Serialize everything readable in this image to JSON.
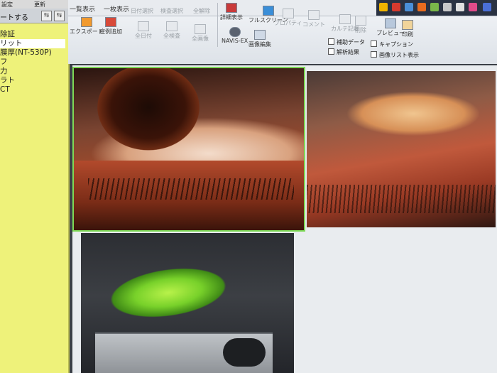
{
  "left_panel": {
    "top_labels": [
      "設定",
      "更新"
    ],
    "row2_label": "ートする",
    "row2_icons": [
      "⇆",
      "⇆"
    ],
    "items": [
      {
        "label": "除証",
        "selected": false
      },
      {
        "label": "リット",
        "selected": true
      },
      {
        "label": "膜厚(NT-530P)",
        "selected": false
      },
      {
        "label": "フ",
        "selected": false
      },
      {
        "label": "力",
        "selected": false
      },
      {
        "label": "ラト",
        "selected": false
      },
      {
        "label": "CT",
        "selected": false
      }
    ]
  },
  "toolbar": {
    "tabs": [
      "一覧表示",
      "一枚表示",
      "日付選択",
      "検査選択",
      "全解除"
    ],
    "buttons": {
      "export": "エクスポート",
      "add_case": "症例追加",
      "all_dates": "全日付",
      "all_exams": "全検査",
      "all_images": "全画像",
      "detail": "詳細表示",
      "fullscreen": "フルスクリーン",
      "property": "プロパティ",
      "comment": "コメント",
      "chart_record": "カルテ記載",
      "delete": "削除",
      "preview": "プレビュー",
      "print": "印刷",
      "navis_ex": "NAVIS-EX",
      "image_edit": "画像編集"
    },
    "checkboxes": [
      {
        "label": "補助データ",
        "checked": false
      },
      {
        "label": "キャプション",
        "checked": false
      },
      {
        "label": "解析結果",
        "checked": false
      },
      {
        "label": "画像リスト表示",
        "checked": false
      }
    ]
  },
  "viewer": {
    "images": [
      {
        "name": "slit-lamp-eye-image-1",
        "selected": true
      },
      {
        "name": "slit-lamp-eye-image-2",
        "selected": false
      },
      {
        "name": "slit-lamp-fluorescein-image-3",
        "selected": false
      }
    ]
  },
  "colors": {
    "left_panel_bg": "#eef27a",
    "selection_outline": "#7ed957",
    "toolbar_bg": "#e8ebef",
    "viewer_bg": "#e9ecef"
  }
}
